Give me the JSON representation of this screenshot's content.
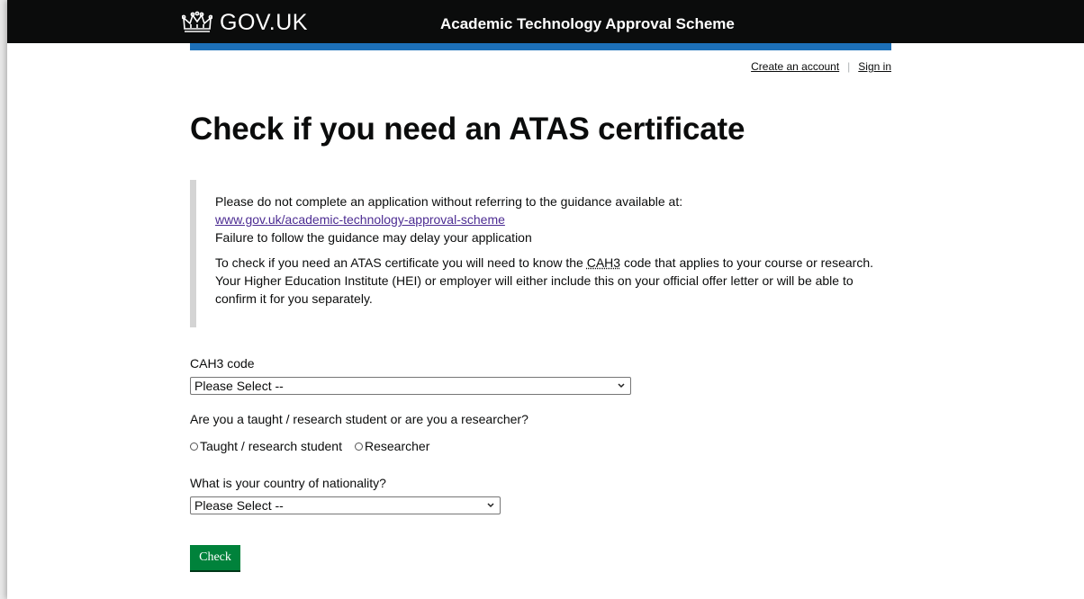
{
  "header": {
    "logo_text": "GOV.UK",
    "service_name": "Academic Technology Approval Scheme"
  },
  "account": {
    "create_account": "Create an account",
    "sign_in": "Sign in",
    "separator": "|"
  },
  "page": {
    "title": "Check if you need an ATAS certificate"
  },
  "inset": {
    "line1": "Please do not complete an application without referring to the guidance available at:",
    "link": "www.gov.uk/academic-technology-approval-scheme",
    "line2": "Failure to follow the guidance may delay your application",
    "para2_before": "To check if you need an ATAS certificate you will need to know the ",
    "para2_abbr": "CAH3",
    "para2_after": " code that applies to your course or research. Your Higher Education Institute (HEI) or employer will either include this on your official offer letter or will be able to confirm it for you separately."
  },
  "form": {
    "cah3_label": "CAH3 code",
    "cah3_value": "Please Select --",
    "student_question": "Are you a taught / research student or are you a researcher?",
    "option_student": "Taught / research student",
    "option_researcher": "Researcher",
    "nationality_label": "What is your country of nationality?",
    "nationality_value": "Please Select --",
    "check_button": "Check"
  },
  "colors": {
    "header_bg": "#0b0c0c",
    "blue_bar": "#1d70b8",
    "button_green": "#00823b",
    "link_purple": "#4c2c92"
  }
}
